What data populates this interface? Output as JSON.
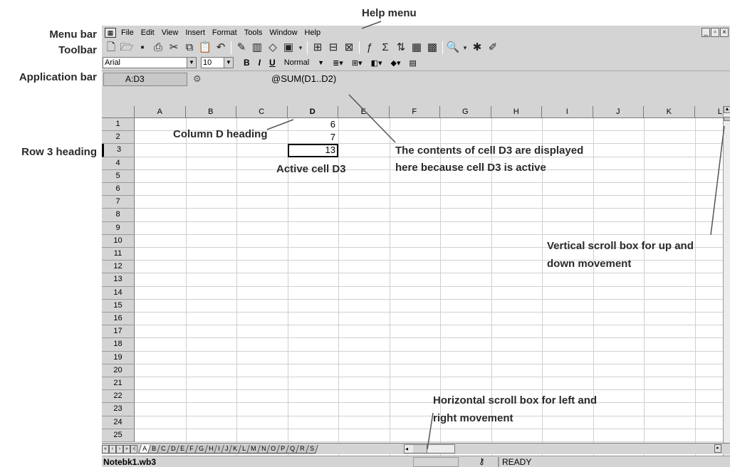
{
  "callouts": {
    "help_menu": "Help menu",
    "menu_bar": "Menu bar",
    "toolbar": "Toolbar",
    "application_bar": "Application bar",
    "row3_heading": "Row 3 heading",
    "column_d_heading": "Column D heading",
    "active_cell": "Active cell D3",
    "cell_contents_line1": "The contents of cell D3 are displayed",
    "cell_contents_line2": "here because cell D3 is active",
    "vertical_scroll_line1": "Vertical scroll box for up and",
    "vertical_scroll_line2": "down movement",
    "horizontal_scroll_line1": "Horizontal scroll box for left and",
    "horizontal_scroll_line2": "right movement"
  },
  "menu": {
    "items": [
      "File",
      "Edit",
      "View",
      "Insert",
      "Format",
      "Tools",
      "Window",
      "Help"
    ]
  },
  "window_controls": [
    "_",
    "▫",
    "×"
  ],
  "toolbar_icons": [
    "new-icon",
    "open-icon",
    "save-icon",
    "print-icon",
    "cut-icon",
    "copy-icon",
    "paste-icon",
    "undo-icon",
    "spellcheck-icon",
    "chart-icon",
    "shape-icon",
    "textbox-icon",
    "insert-cells-icon",
    "insert-rows-icon",
    "insert-columns-icon",
    "function-icon",
    "sum-icon",
    "sort-icon",
    "table-icon",
    "grid-icon",
    "zoom-icon",
    "expert-icon",
    "draw-icon"
  ],
  "properties_bar": {
    "font": "Arial",
    "size": "10",
    "bold": "B",
    "italic": "I",
    "underline": "U",
    "style": "Normal"
  },
  "application_bar": {
    "address": "A:D3",
    "formula": "@SUM(D1..D2)"
  },
  "grid": {
    "columns": [
      "A",
      "B",
      "C",
      "D",
      "E",
      "F",
      "G",
      "H",
      "I",
      "J",
      "K",
      "L"
    ],
    "rows": [
      "1",
      "2",
      "3",
      "4",
      "5",
      "6",
      "7",
      "8",
      "9",
      "10",
      "11",
      "12",
      "13",
      "14",
      "15",
      "16",
      "17",
      "18",
      "19",
      "20",
      "21",
      "22",
      "23",
      "24",
      "25"
    ],
    "cells": {
      "D1": "6",
      "D2": "7",
      "D3": "13"
    },
    "active_cell": "D3"
  },
  "sheet_tabs": [
    "A",
    "B",
    "C",
    "D",
    "E",
    "F",
    "G",
    "H",
    "I",
    "J",
    "K",
    "L",
    "M",
    "N",
    "O",
    "P",
    "Q",
    "R",
    "S"
  ],
  "status": {
    "filename": "Notebk1.wb3",
    "mode": "READY"
  }
}
